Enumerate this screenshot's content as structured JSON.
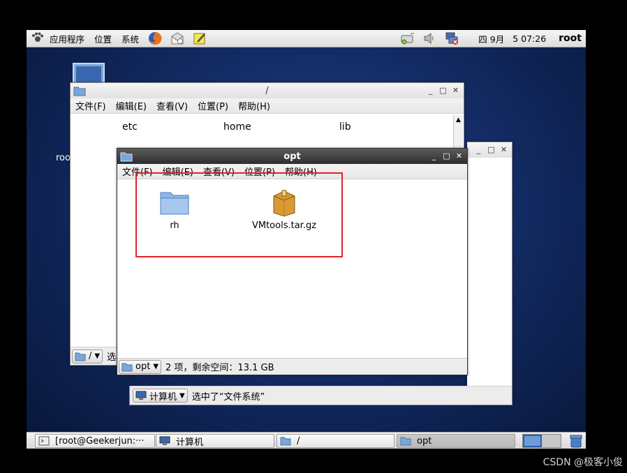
{
  "top_panel": {
    "menus": [
      "应用程序",
      "位置",
      "系统"
    ],
    "date": "四 9月",
    "time": "5 07:26",
    "user": "root"
  },
  "desktop": {
    "partial_label": "roo"
  },
  "fs_window": {
    "title": "/",
    "menu": [
      "文件(F)",
      "编辑(E)",
      "查看(V)",
      "位置(P)",
      "帮助(H)"
    ],
    "items": [
      "etc",
      "home",
      "lib"
    ],
    "location": "/",
    "status_partial": "选"
  },
  "computer_window": {
    "location": "计算机",
    "status": "选中了“文件系统”"
  },
  "opt_window": {
    "title": "opt",
    "menu": [
      "文件(F)",
      "编辑(E)",
      "查看(V)",
      "位置(P)",
      "帮助(H)"
    ],
    "items": [
      {
        "name": "rh",
        "icon": "folder-icon"
      },
      {
        "name": "VMtools.tar.gz",
        "icon": "archive-icon"
      }
    ],
    "location": "opt",
    "status": "2 项，剩余空间：13.1 GB"
  },
  "taskbar": [
    {
      "label": "[root@Geekerjun:···",
      "icon": "terminal-icon"
    },
    {
      "label": "计算机",
      "icon": "computer-icon"
    },
    {
      "label": "/",
      "icon": "folder-icon"
    },
    {
      "label": "opt",
      "icon": "folder-icon"
    }
  ],
  "watermark": "CSDN @极客小俊",
  "colors": {
    "highlight": "#e0222a",
    "desktop": "#132c66",
    "active_title": "#2d2d2d"
  }
}
